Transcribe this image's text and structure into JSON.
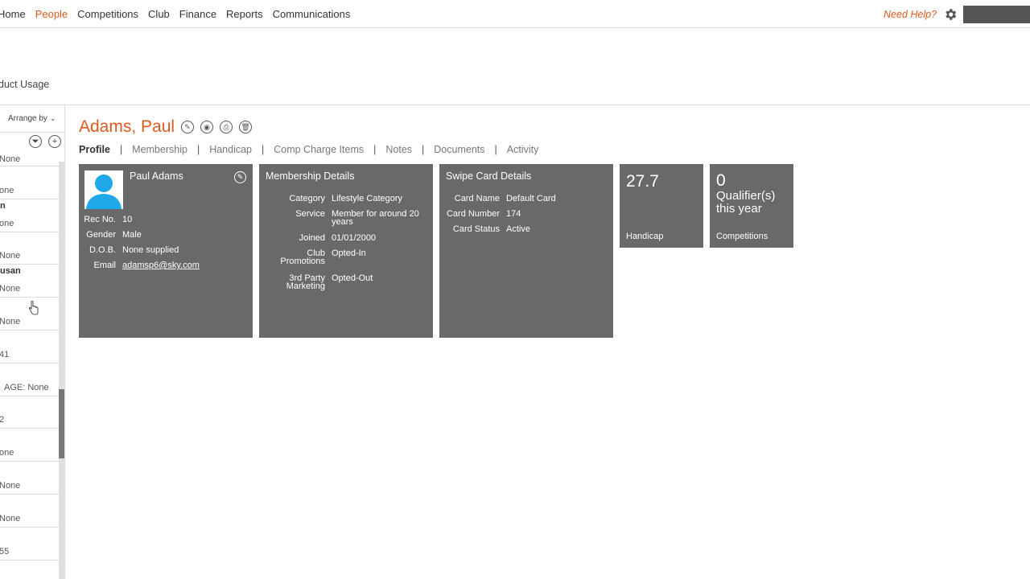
{
  "topnav": {
    "items": [
      "Home",
      "People",
      "Competitions",
      "Club",
      "Finance",
      "Reports",
      "Communications"
    ],
    "active": "People",
    "need_help": "Need Help?"
  },
  "subtitle": "duct Usage",
  "sidebar": {
    "arrange_label": "Arrange by",
    "list": [
      {
        "name": "",
        "value": "None"
      },
      {
        "name": "",
        "value": "one"
      },
      {
        "name": "n",
        "value": "one"
      },
      {
        "name": "",
        "value": "None"
      },
      {
        "name": "usan",
        "value": "None"
      },
      {
        "name": "",
        "value": "None"
      },
      {
        "name": "",
        "value": "41"
      },
      {
        "name": "",
        "value": "AGE: None"
      },
      {
        "name": "",
        "value": "2"
      },
      {
        "name": "",
        "value": "one"
      },
      {
        "name": "",
        "value": "None"
      },
      {
        "name": "",
        "value": "None"
      },
      {
        "name": "",
        "value": "55"
      }
    ]
  },
  "profile": {
    "name": "Adams, Paul",
    "tabs": [
      "Profile",
      "Membership",
      "Handicap",
      "Comp Charge Items",
      "Notes",
      "Documents",
      "Activity"
    ],
    "active_tab": "Profile",
    "person_card": {
      "full_name": "Paul Adams",
      "rows": [
        {
          "label": "Rec No.",
          "value": "10"
        },
        {
          "label": "Gender",
          "value": "Male"
        },
        {
          "label": "D.O.B.",
          "value": "None supplied"
        },
        {
          "label": "Email",
          "value": "adamsp6@sky.com"
        }
      ]
    },
    "membership_card": {
      "title": "Membership Details",
      "rows": [
        {
          "label": "Category",
          "value": "Lifestyle Category"
        },
        {
          "label": "Service",
          "value": "Member for around 20 years"
        },
        {
          "label": "Joined",
          "value": "01/01/2000"
        },
        {
          "label": "Club Promotions",
          "value": "Opted-In"
        },
        {
          "label": "3rd Party Marketing",
          "value": "Opted-Out"
        }
      ]
    },
    "swipe_card": {
      "title": "Swipe Card Details",
      "rows": [
        {
          "label": "Card Name",
          "value": "Default Card"
        },
        {
          "label": "Card Number",
          "value": "174"
        },
        {
          "label": "Card Status",
          "value": "Active"
        }
      ]
    },
    "handicap_tile": {
      "value": "27.7",
      "label": "Handicap"
    },
    "competitions_tile": {
      "value": "0",
      "text": "Qualifier(s) this year",
      "label": "Competitions"
    }
  },
  "colors": {
    "accent": "#e05a1e",
    "card_bg": "#696969",
    "avatar": "#1ea8e8"
  },
  "icons": [
    "settings-gear-icon",
    "filter-icon",
    "add-icon",
    "edit-icon",
    "camera-icon",
    "print-icon",
    "delete-icon",
    "user-avatar-icon"
  ]
}
